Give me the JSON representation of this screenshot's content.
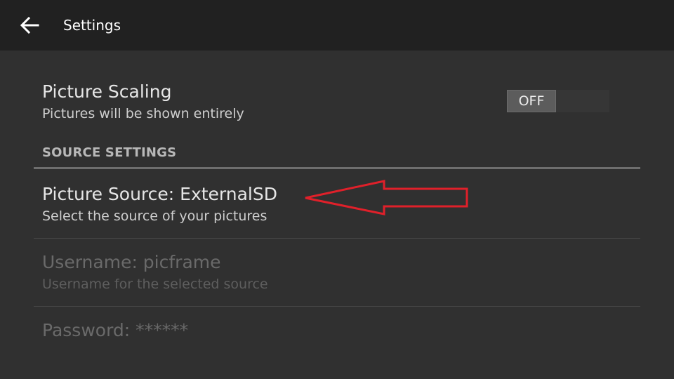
{
  "action_bar": {
    "title": "Settings",
    "back_icon": "arrow-left-icon"
  },
  "preferences": {
    "picture_scaling": {
      "title": "Picture Scaling",
      "summary": "Pictures will be shown entirely",
      "toggle_state": "OFF"
    },
    "source_settings_header": "SOURCE SETTINGS",
    "picture_source": {
      "title": "Picture Source: ExternalSD",
      "summary": "Select the source of your pictures"
    },
    "username": {
      "title": "Username: picframe",
      "summary": "Username for the selected source",
      "enabled": false
    },
    "password": {
      "title": "Password: ******",
      "enabled": false
    }
  },
  "annotation": {
    "shape": "arrow-left",
    "color": "#e0202a"
  }
}
